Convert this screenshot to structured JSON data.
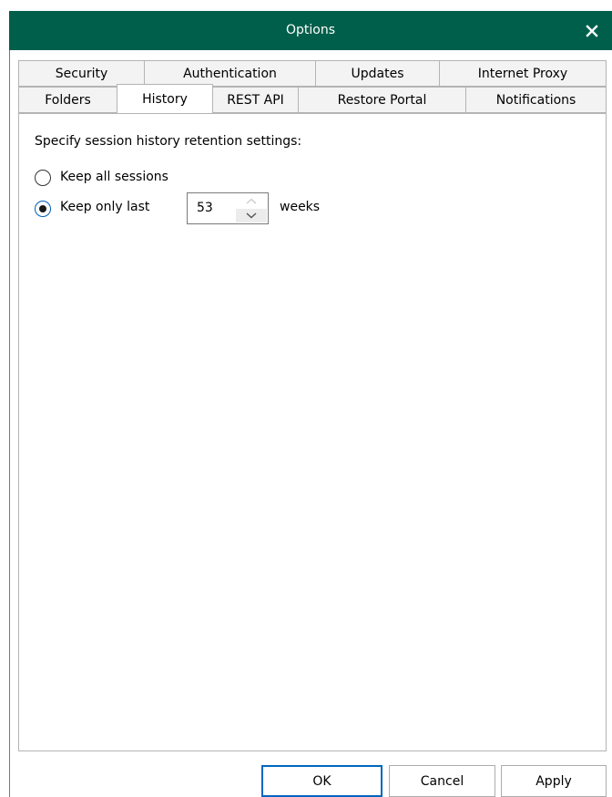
{
  "window": {
    "title": "Options",
    "title_bar_color": "#005f4b"
  },
  "tabs": {
    "row1": [
      {
        "label": "Security"
      },
      {
        "label": "Authentication"
      },
      {
        "label": "Updates"
      },
      {
        "label": "Internet Proxy"
      }
    ],
    "row2": [
      {
        "label": "Folders"
      },
      {
        "label": "History",
        "active": true
      },
      {
        "label": "REST API"
      },
      {
        "label": "Restore Portal"
      },
      {
        "label": "Notifications"
      }
    ]
  },
  "history": {
    "heading": "Specify session history retention settings:",
    "option_all": {
      "label": "Keep all sessions",
      "checked": false
    },
    "option_last": {
      "label": "Keep only last",
      "checked": true
    },
    "weeks_value": "53",
    "weeks_unit": "weeks"
  },
  "buttons": {
    "ok": "OK",
    "cancel": "Cancel",
    "apply": "Apply"
  }
}
